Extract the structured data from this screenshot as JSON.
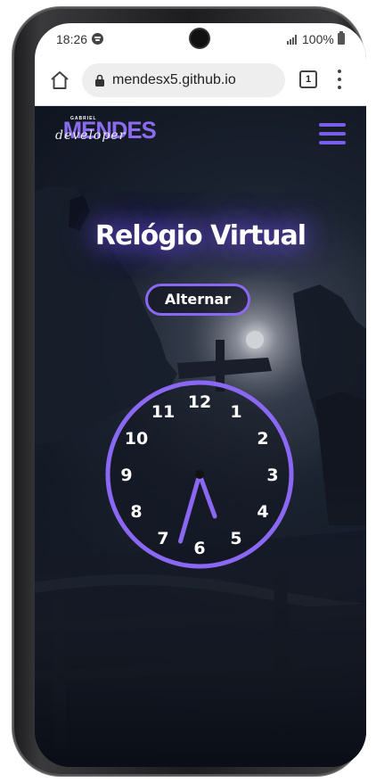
{
  "status_bar": {
    "time": "18:26",
    "battery": "100%",
    "icons": [
      "spotify-icon",
      "signal-icon",
      "battery-icon"
    ]
  },
  "browser": {
    "url": "mendesx5.github.io",
    "tab_count": "1",
    "icons": [
      "home-icon",
      "lock-icon",
      "tabs-icon",
      "menu-icon"
    ]
  },
  "site": {
    "logo": {
      "small": "GABRIEL",
      "main": "MENDES",
      "script": "developer"
    },
    "title": "Relógio Virtual",
    "toggle_label": "Alternar"
  },
  "clock": {
    "numbers": [
      "12",
      "1",
      "2",
      "3",
      "4",
      "5",
      "6",
      "7",
      "8",
      "9",
      "10",
      "11"
    ],
    "hour_hand_deg": 160,
    "minute_hand_deg": 196,
    "accent_color": "#8b68f3"
  },
  "colors": {
    "accent": "#8b6cf0",
    "background": "#121924"
  }
}
